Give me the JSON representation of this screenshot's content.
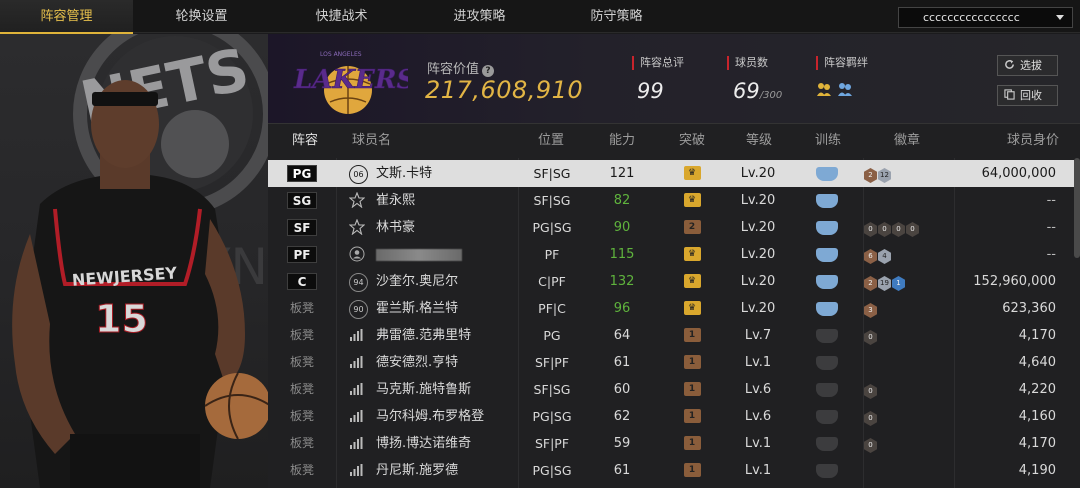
{
  "tabs": [
    "阵容管理",
    "轮换设置",
    "快捷战术",
    "进攻策略",
    "防守策略"
  ],
  "lineup_select": "cccccccccccccccc",
  "team": {
    "logo_text": "LAKERS",
    "logo_subtext": "LOS ANGELES",
    "value_label": "阵容价值",
    "value": "217,608,910",
    "rating_label": "阵容总评",
    "rating": "99",
    "players_label": "球员数",
    "players": "69",
    "players_max": "/300",
    "bond_label": "阵容羁绊"
  },
  "buttons": {
    "pick": "选拔",
    "recycle": "回收"
  },
  "columns": [
    "阵容",
    "球员名",
    "位置",
    "能力",
    "突破",
    "等级",
    "训练",
    "徽章",
    "球员身价"
  ],
  "hero": {
    "team_text": "NETS",
    "jersey_team": "NEWJERSEY",
    "jersey_number": "15"
  },
  "rows": [
    {
      "slot": "PG",
      "starter": true,
      "icon": "06",
      "name": "文斯.卡特",
      "position": "SF|SG",
      "ability": "121",
      "ability_color": "white",
      "breakthrough": "gold",
      "level": "Lv.20",
      "training": "blue",
      "badges": [
        [
          "br",
          "2"
        ],
        [
          "sv",
          "12"
        ]
      ],
      "value": "64,000,000",
      "selected": true
    },
    {
      "slot": "SG",
      "starter": true,
      "icon": "star",
      "name": "崔永熙",
      "position": "SF|SG",
      "ability": "82",
      "ability_color": "green",
      "breakthrough": "gold",
      "level": "Lv.20",
      "training": "blue",
      "badges": [],
      "value": "--"
    },
    {
      "slot": "SF",
      "starter": true,
      "icon": "star",
      "name": "林书豪",
      "position": "PG|SG",
      "ability": "90",
      "ability_color": "green",
      "breakthrough": "bronze2",
      "level": "Lv.20",
      "training": "blue",
      "badges": [
        [
          "dk",
          "0"
        ],
        [
          "dk",
          "0"
        ],
        [
          "dk",
          "0"
        ],
        [
          "dk",
          "0"
        ]
      ],
      "value": "--"
    },
    {
      "slot": "PF",
      "starter": true,
      "icon": "person",
      "name": "",
      "name_blurred": true,
      "position": "PF",
      "ability": "115",
      "ability_color": "green",
      "breakthrough": "gold",
      "level": "Lv.20",
      "training": "blue",
      "badges": [
        [
          "br",
          "6"
        ],
        [
          "sv",
          "4"
        ]
      ],
      "value": "--"
    },
    {
      "slot": "C",
      "starter": true,
      "icon": "94",
      "name": "沙奎尔.奥尼尔",
      "position": "C|PF",
      "ability": "132",
      "ability_color": "green",
      "breakthrough": "gold",
      "level": "Lv.20",
      "training": "blue",
      "badges": [
        [
          "br",
          "2"
        ],
        [
          "sv",
          "19"
        ],
        [
          "bl",
          "1"
        ]
      ],
      "value": "152,960,000"
    },
    {
      "slot": "板凳",
      "starter": false,
      "icon": "90",
      "name": "霍兰斯.格兰特",
      "position": "PF|C",
      "ability": "96",
      "ability_color": "green",
      "breakthrough": "gold",
      "level": "Lv.20",
      "training": "blue",
      "badges": [
        [
          "br",
          "3"
        ]
      ],
      "value": "623,360"
    },
    {
      "slot": "板凳",
      "starter": false,
      "icon": "bars",
      "name": "弗雷德.范弗里特",
      "position": "PG",
      "ability": "64",
      "ability_color": "white",
      "breakthrough": "bronze1",
      "level": "Lv.7",
      "training": "grey",
      "badges": [
        [
          "dk",
          "0"
        ]
      ],
      "value": "4,170"
    },
    {
      "slot": "板凳",
      "starter": false,
      "icon": "bars",
      "name": "德安德烈.亨特",
      "position": "SF|PF",
      "ability": "61",
      "ability_color": "white",
      "breakthrough": "bronze1",
      "level": "Lv.1",
      "training": "grey",
      "badges": [],
      "value": "4,640"
    },
    {
      "slot": "板凳",
      "starter": false,
      "icon": "bars",
      "name": "马克斯.施特鲁斯",
      "position": "SF|SG",
      "ability": "60",
      "ability_color": "white",
      "breakthrough": "bronze1",
      "level": "Lv.6",
      "training": "grey",
      "badges": [
        [
          "dk",
          "0"
        ]
      ],
      "value": "4,220"
    },
    {
      "slot": "板凳",
      "starter": false,
      "icon": "bars",
      "name": "马尔科姆.布罗格登",
      "position": "PG|SG",
      "ability": "62",
      "ability_color": "white",
      "breakthrough": "bronze1",
      "level": "Lv.6",
      "training": "grey",
      "badges": [
        [
          "dk",
          "0"
        ]
      ],
      "value": "4,160"
    },
    {
      "slot": "板凳",
      "starter": false,
      "icon": "bars",
      "name": "博扬.博达诺维奇",
      "position": "SF|PF",
      "ability": "59",
      "ability_color": "white",
      "breakthrough": "bronze1",
      "level": "Lv.1",
      "training": "grey",
      "badges": [
        [
          "dk",
          "0"
        ]
      ],
      "value": "4,170"
    },
    {
      "slot": "板凳",
      "starter": false,
      "icon": "bars",
      "name": "丹尼斯.施罗德",
      "position": "PG|SG",
      "ability": "61",
      "ability_color": "white",
      "breakthrough": "bronze1",
      "level": "Lv.1",
      "training": "grey",
      "badges": [],
      "value": "4,190"
    }
  ]
}
